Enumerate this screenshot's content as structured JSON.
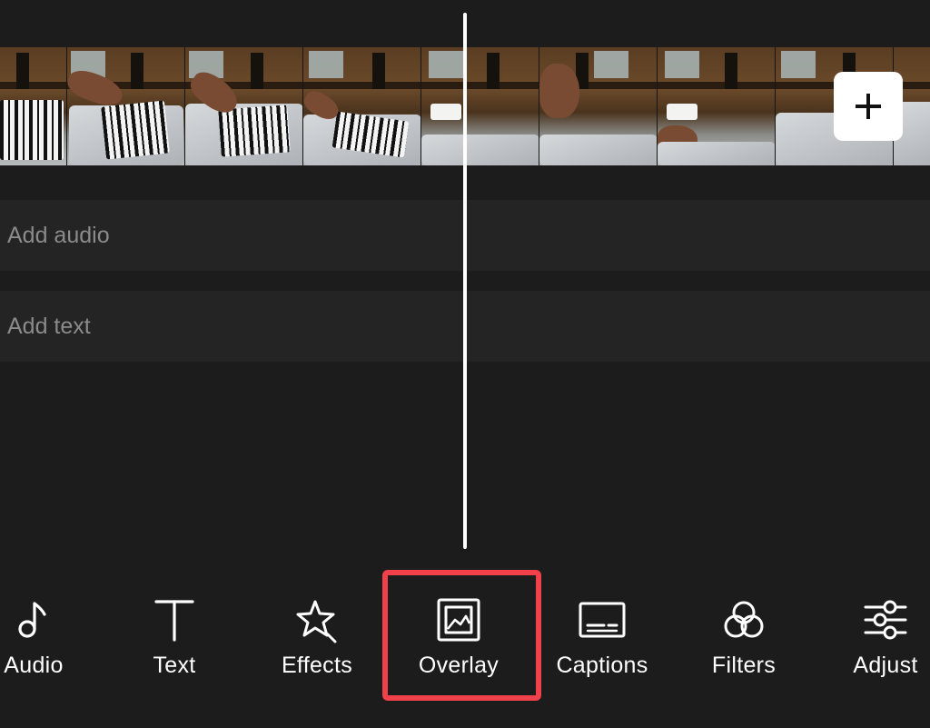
{
  "timeline": {
    "add_clip_icon": "plus-icon",
    "frame_count": 8
  },
  "tracks": {
    "audio_placeholder": "Add audio",
    "text_placeholder": "Add text"
  },
  "toolbar": {
    "items": [
      {
        "id": "audio",
        "label": "Audio",
        "icon": "music-note-icon"
      },
      {
        "id": "text",
        "label": "Text",
        "icon": "text-t-icon"
      },
      {
        "id": "effects",
        "label": "Effects",
        "icon": "sparkle-star-icon"
      },
      {
        "id": "overlay",
        "label": "Overlay",
        "icon": "picture-overlay-icon"
      },
      {
        "id": "captions",
        "label": "Captions",
        "icon": "captions-icon"
      },
      {
        "id": "filters",
        "label": "Filters",
        "icon": "filters-circles-icon"
      },
      {
        "id": "adjust",
        "label": "Adjust",
        "icon": "sliders-icon"
      }
    ],
    "highlighted": "overlay"
  },
  "colors": {
    "background": "#1c1c1c",
    "track": "#242424",
    "highlight": "#f0404a",
    "placeholder_text": "#8b8b8b"
  }
}
